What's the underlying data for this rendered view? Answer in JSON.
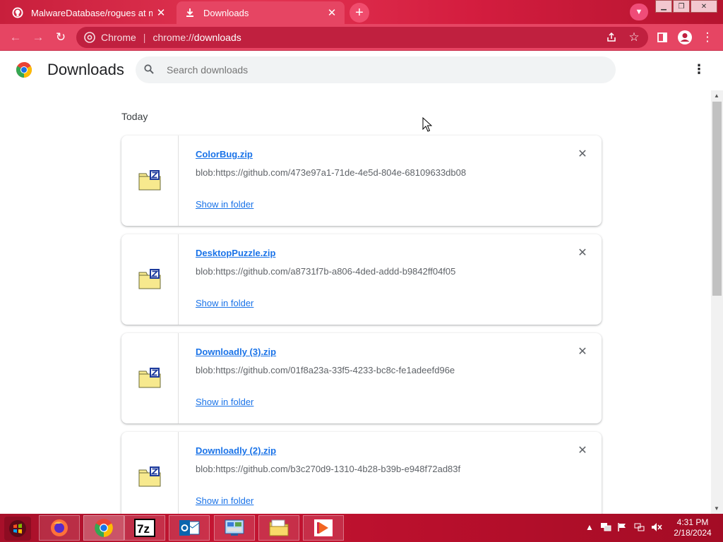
{
  "tabs": [
    {
      "title": "MalwareDatabase/rogues at mas",
      "close": "✕",
      "icon": "github-icon"
    },
    {
      "title": "Downloads",
      "close": "✕",
      "icon": "download-icon"
    }
  ],
  "new_tab": "+",
  "address_bar": {
    "chip": "Chrome",
    "url_scheme": "chrome://",
    "url_host": "downloads"
  },
  "page": {
    "title": "Downloads",
    "search_placeholder": "Search downloads",
    "section": "Today"
  },
  "downloads": [
    {
      "name": "ColorBug.zip",
      "url": "blob:https://github.com/473e97a1-71de-4e5d-804e-68109633db08",
      "action": "Show in folder"
    },
    {
      "name": "DesktopPuzzle.zip",
      "url": "blob:https://github.com/a8731f7b-a806-4ded-addd-b9842ff04f05",
      "action": "Show in folder"
    },
    {
      "name": "Downloadly (3).zip",
      "url": "blob:https://github.com/01f8a23a-33f5-4233-bc8c-fe1adeefd96e",
      "action": "Show in folder"
    },
    {
      "name": "Downloadly (2).zip",
      "url": "blob:https://github.com/b3c270d9-1310-4b28-b39b-e948f72ad83f",
      "action": "Show in folder"
    }
  ],
  "taskbar": {
    "apps": [
      "firefox",
      "chrome",
      "7-zip",
      "outlook",
      "control-panel",
      "file-explorer",
      "media-player"
    ],
    "clock_time": "4:31 PM",
    "clock_date": "2/18/2024"
  },
  "colors": {
    "theme": "#e64563",
    "link": "#1a73e8"
  }
}
